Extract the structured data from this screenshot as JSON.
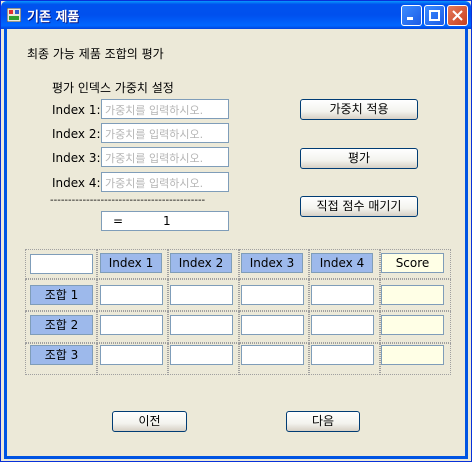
{
  "window": {
    "title": "기존 제품",
    "controls": {
      "minimize": "minimize-icon",
      "maximize": "maximize-icon",
      "close": "close-icon"
    }
  },
  "heading": "최종 가능 제품 조합의 평가",
  "weights": {
    "section_label": "평가 인덱스 가중치 설정",
    "rows": [
      {
        "label": "Index 1:",
        "placeholder": "가중치를 입력하시오."
      },
      {
        "label": "Index 2:",
        "placeholder": "가중치를 입력하시오."
      },
      {
        "label": "Index 3:",
        "placeholder": "가중치를 입력하시오."
      },
      {
        "label": "Index 4:",
        "placeholder": "가중치를 입력하시오."
      }
    ],
    "divider": "-------------------------------------------",
    "sum_prefix": "=",
    "sum_value": "1"
  },
  "buttons": {
    "apply_weights": "가중치 적용",
    "evaluate": "평가",
    "direct_score": "직접 점수 매기기",
    "prev": "이전",
    "next": "다음"
  },
  "table": {
    "headers": [
      "Index 1",
      "Index 2",
      "Index 3",
      "Index 4",
      "Score"
    ],
    "rows": [
      "조합 1",
      "조합 2",
      "조합 3"
    ]
  },
  "colors": {
    "titlebar": "#0054E3",
    "dialog_bg": "#ECE9D8",
    "header_fill": "#9DB9EB",
    "score_fill": "#FFFFE6"
  }
}
